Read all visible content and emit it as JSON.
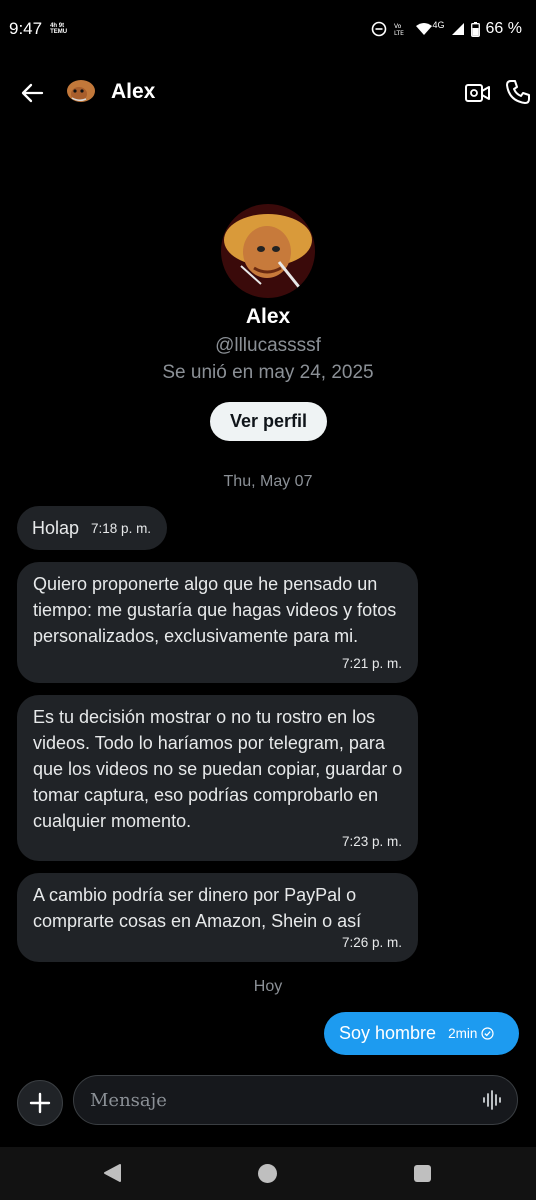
{
  "status_bar": {
    "time": "9:47",
    "mini_labels": "4h 9t TEMU",
    "network": "4G",
    "battery": "66 %"
  },
  "header": {
    "name": "Alex"
  },
  "profile": {
    "name": "Alex",
    "handle": "@lllucassssf",
    "joined": "Se unió en may 24, 2025",
    "view_profile_label": "Ver perfil"
  },
  "date_separators": [
    "Thu, May 07",
    "Hoy"
  ],
  "messages": [
    {
      "text": "Holap",
      "time": "7:18 p. m."
    },
    {
      "text": "Quiero proponerte algo que he pensado un tiempo: me gustaría que hagas videos y fotos personalizados, exclusivamente para mi.",
      "time": "7:21 p. m."
    },
    {
      "text": "Es tu decisión mostrar o no tu rostro en los videos. Todo lo haríamos por telegram, para que los videos no se puedan copiar, guardar o tomar captura, eso podrías comprobarlo en cualquier momento.",
      "time": "7:23 p. m."
    },
    {
      "text": "A cambio podría ser dinero por PayPal o comprarte cosas en Amazon, Shein o así",
      "time": "7:26 p. m."
    }
  ],
  "own_message": {
    "text": "Soy hombre",
    "time": "2min"
  },
  "composer": {
    "placeholder": "Mensaje"
  },
  "colors": {
    "accent": "#1d9bf0",
    "bubble": "#202327",
    "background": "#000000",
    "muted": "#8b9096"
  },
  "icons": [
    "back-arrow-icon",
    "video-call-icon",
    "phone-icon",
    "plus-icon",
    "voice-wave-icon",
    "sent-check-icon"
  ]
}
